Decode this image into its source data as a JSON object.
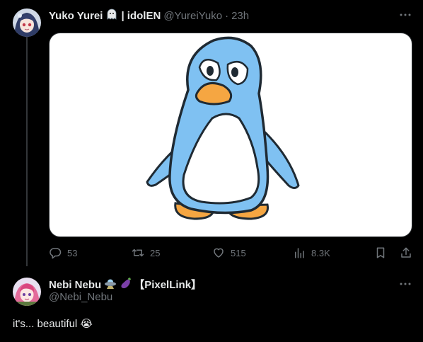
{
  "tweet": {
    "display_name": "Yuko Yurei",
    "name_suffix": "| idolEN",
    "handle": "@YureiYuko",
    "separator": "·",
    "time": "23h",
    "stats": {
      "replies": "53",
      "reposts": "25",
      "likes": "515",
      "views": "8.3K"
    }
  },
  "reply": {
    "display_name": "Nebi Nebu",
    "name_suffix": "【PixelLink】",
    "handle": "@Nebi_Nebu",
    "text": "it's... beautiful",
    "text_emoji": "😭"
  },
  "colors": {
    "background": "#000000",
    "text_primary": "#e7e9ea",
    "text_secondary": "#71767b",
    "thread_line": "#333639",
    "penguin_blue": "#7fc1f2",
    "penguin_orange": "#f5a642"
  },
  "icons": {
    "tweet_badge": "ghost-emoji",
    "reply_badges": [
      "ufo-emoji",
      "eggplant-emoji"
    ],
    "actions": [
      "reply-icon",
      "repost-icon",
      "like-icon",
      "views-icon",
      "bookmark-icon",
      "share-icon"
    ]
  }
}
